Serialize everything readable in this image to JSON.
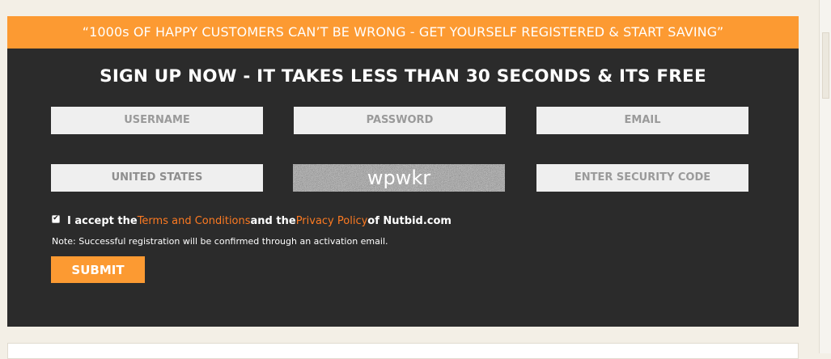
{
  "banner": {
    "text": "“1000s OF HAPPY CUSTOMERS CAN’T BE WRONG - GET YOURSELF REGISTERED & START SAVING”"
  },
  "form": {
    "title": "SIGN UP NOW - IT TAKES LESS THAN 30 SECONDS & ITS FREE",
    "username_placeholder": "USERNAME",
    "password_placeholder": "PASSWORD",
    "email_placeholder": "EMAIL",
    "country_selected": "UNITED STATES",
    "captcha_text": "wpwkr",
    "security_code_placeholder": "ENTER SECURITY CODE",
    "accept_checked": true,
    "accept_prefix": "I accept the ",
    "terms_link": "Terms and Conditions",
    "accept_middle": " and the ",
    "privacy_link": "Privacy Policy",
    "accept_suffix": " of Nutbid.com",
    "note": "Note: Successful registration will be confirmed through an activation email.",
    "submit_label": "SUBMIT"
  },
  "colors": {
    "accent": "#fc9a32",
    "panel": "#2b2b2b",
    "link": "#fc7a22",
    "page_bg": "#f3efe6"
  }
}
